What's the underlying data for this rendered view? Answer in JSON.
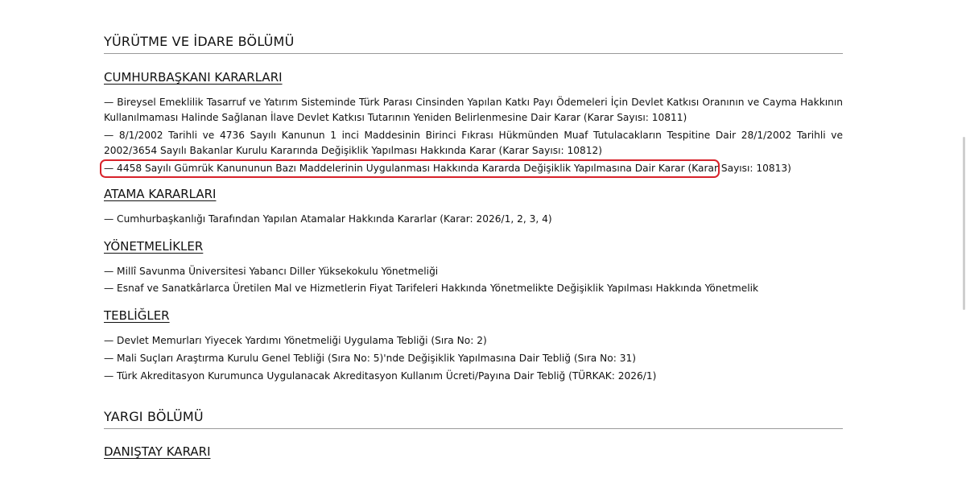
{
  "sections": {
    "yurutme": {
      "title": "YÜRÜTME VE İDARE BÖLÜMÜ",
      "cumhurbaskani": {
        "title": "CUMHURBAŞKANI KARARLARI",
        "items": [
          "— Bireysel Emeklilik Tasarruf ve Yatırım Sisteminde Türk Parası Cinsinden Yapılan Katkı Payı Ödemeleri İçin Devlet Katkısı Oranının ve Cayma Hakkının Kullanılmaması Halinde Sağlanan İlave Devlet Katkısı Tutarının Yeniden Belirlenmesine Dair Karar (Karar Sayısı: 10811)",
          "— 8/1/2002 Tarihli ve 4736 Sayılı Kanunun 1 inci Maddesinin Birinci Fıkrası Hükmünden Muaf Tutulacakların Tespitine Dair 28/1/2002 Tarihli ve 2002/3654 Sayılı Bakanlar Kurulu Kararında Değişiklik Yapılması Hakkında Karar (Karar Sayısı: 10812)",
          "— 4458 Sayılı Gümrük Kanununun Bazı Maddelerinin Uygulanması Hakkında Kararda Değişiklik Yapılmasına Dair Karar (Karar Sayısı: 10813)"
        ]
      },
      "atama": {
        "title": "ATAMA KARARLARI",
        "items": [
          "— Cumhurbaşkanlığı Tarafından Yapılan Atamalar Hakkında Kararlar (Karar: 2026/1, 2, 3, 4)"
        ]
      },
      "yonetmelikler": {
        "title": "YÖNETMELİKLER",
        "items": [
          "— Millî Savunma Üniversitesi Yabancı Diller Yüksekokulu Yönetmeliği",
          "— Esnaf ve Sanatkârlarca Üretilen Mal ve Hizmetlerin Fiyat Tarifeleri Hakkında Yönetmelikte Değişiklik Yapılması Hakkında Yönetmelik"
        ]
      },
      "teblig": {
        "title": "TEBLİĞLER",
        "items": [
          "— Devlet Memurları Yiyecek Yardımı Yönetmeliği Uygulama Tebliği (Sıra No: 2)",
          "— Mali Suçları Araştırma Kurulu Genel Tebliği (Sıra No: 5)'nde Değişiklik Yapılmasına Dair Tebliğ (Sıra No: 31)",
          "— Türk Akreditasyon Kurumunca Uygulanacak Akreditasyon Kullanım Ücreti/Payına Dair Tebliğ (TÜRKAK: 2026/1)"
        ]
      }
    },
    "yargi": {
      "title": "YARGI BÖLÜMÜ",
      "danistay": {
        "title": "DANIŞTAY KARARI"
      }
    }
  },
  "colors": {
    "highlight": "#d8222a",
    "rule": "#9a9a9a",
    "text": "#111111"
  }
}
